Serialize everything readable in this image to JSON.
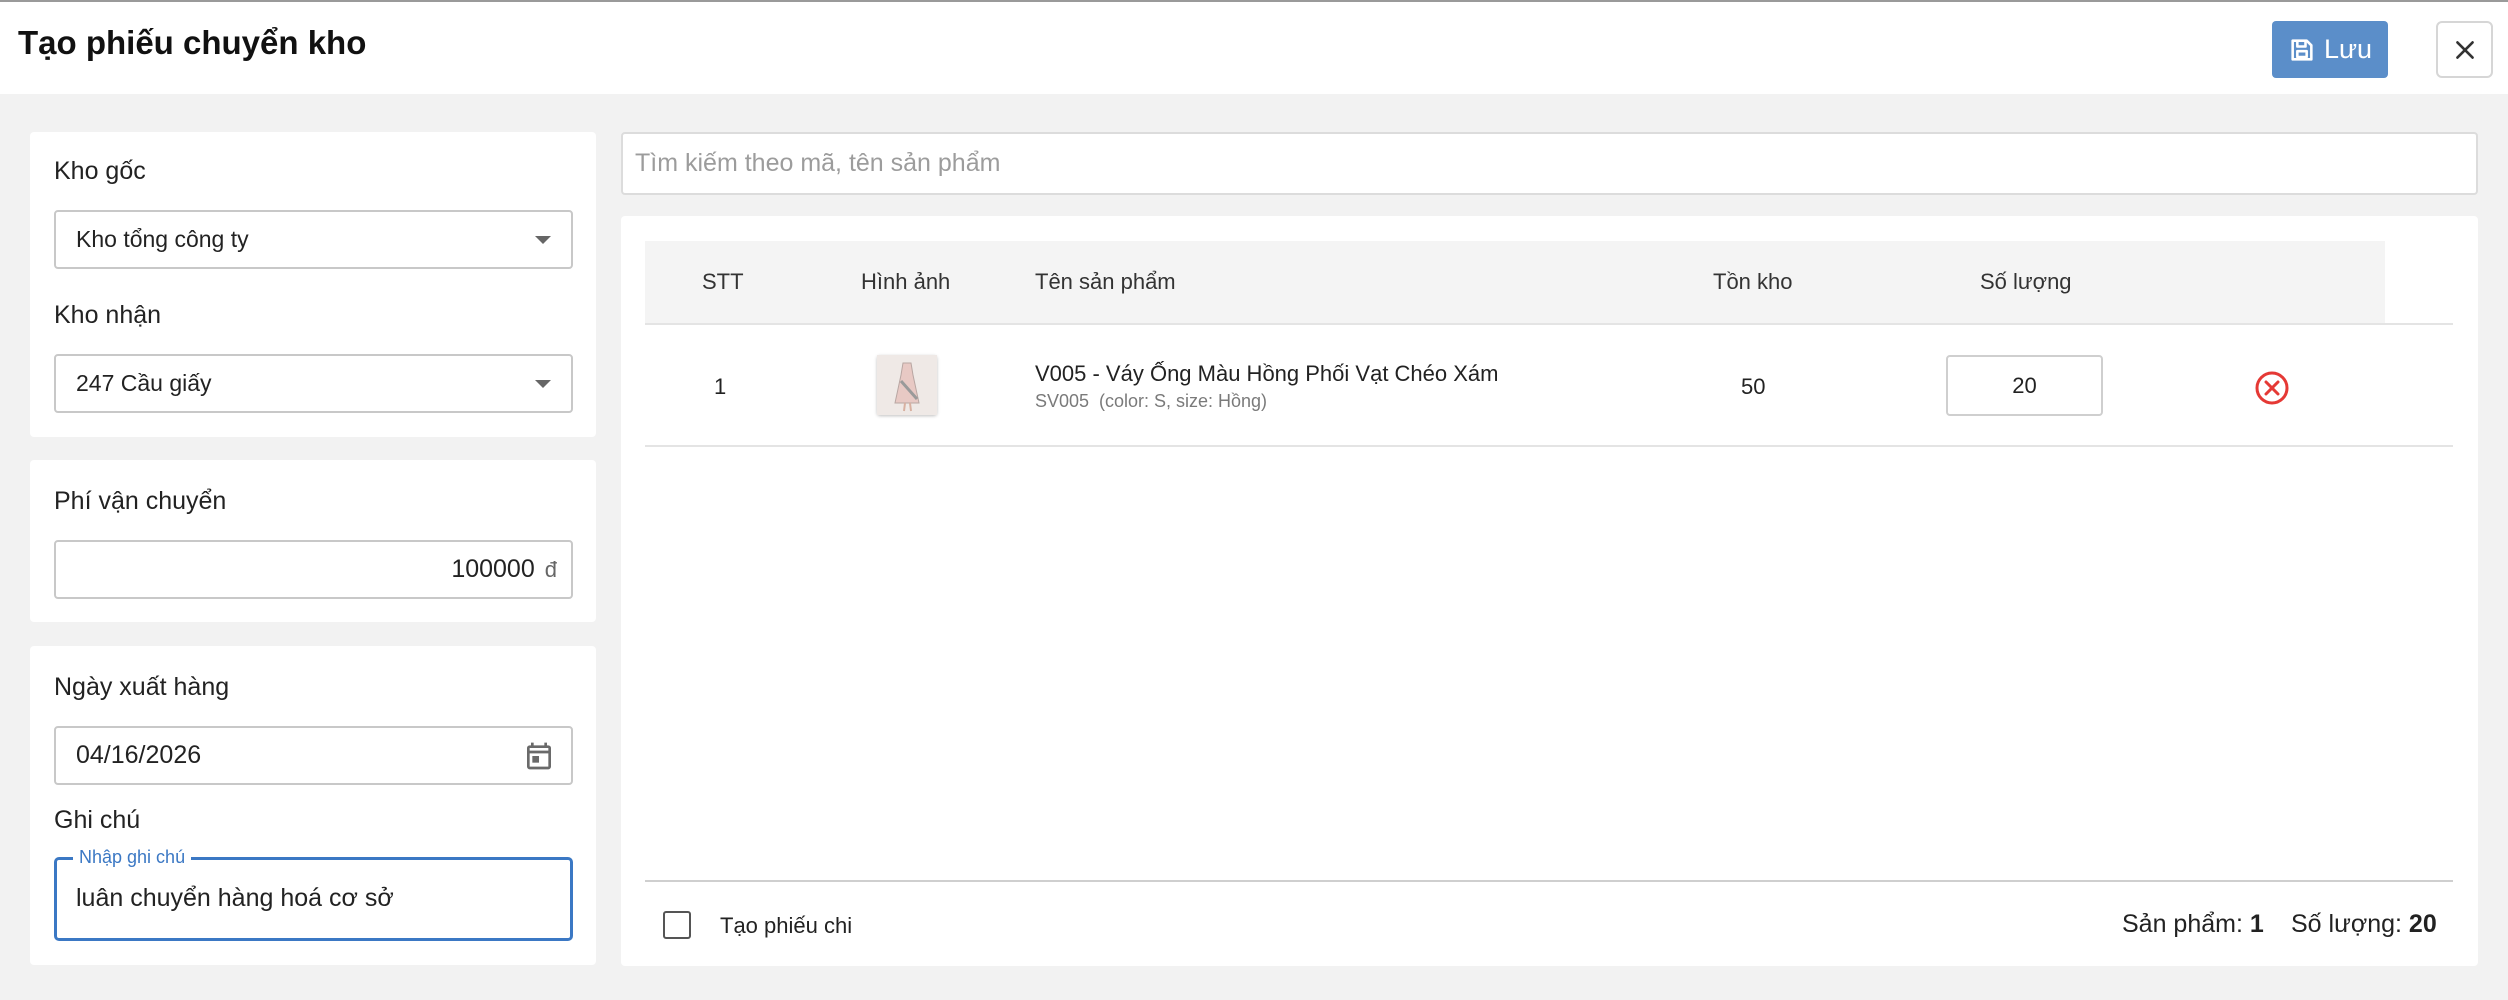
{
  "header": {
    "title": "Tạo phiếu chuyển kho",
    "save_label": "Lưu"
  },
  "warehouse": {
    "source_label": "Kho gốc",
    "source_value": "Kho tổng công ty",
    "target_label": "Kho nhận",
    "target_value": "247 Cầu giấy"
  },
  "shipping": {
    "label": "Phí vận chuyển",
    "value": "100000",
    "currency": "đ"
  },
  "details": {
    "date_label": "Ngày xuất hàng",
    "date_value": "04/16/2026",
    "note_label": "Ghi chú",
    "note_legend": "Nhập ghi chú",
    "note_value": "luân chuyển hàng hoá cơ sở"
  },
  "search": {
    "placeholder": "Tìm kiếm theo mã, tên sản phẩm"
  },
  "table": {
    "columns": [
      "STT",
      "Hình ảnh",
      "Tên sản phẩm",
      "Tồn kho",
      "Số lượng"
    ],
    "rows": [
      {
        "stt": "1",
        "name": "V005 - Váy Ống Màu Hồng Phối Vạt Chéo Xám",
        "sku": "SV005",
        "variant": "(color: S, size: Hồng)",
        "stock": "50",
        "quantity": "20"
      }
    ]
  },
  "footer": {
    "create_voucher_label": "Tạo phiếu chi",
    "products_label": "Sản phẩm:",
    "products_count": "1",
    "quantity_label": "Số lượng:",
    "quantity_total": "20"
  },
  "colors": {
    "primary": "#5b8ec9",
    "focus": "#3b78c4",
    "danger": "#e53935"
  }
}
